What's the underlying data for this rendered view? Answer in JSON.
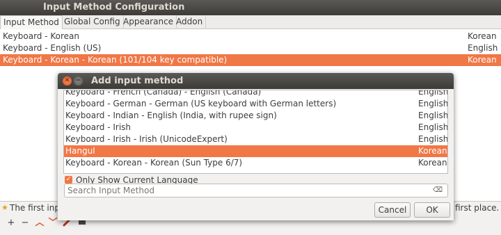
{
  "window": {
    "title": "Input Method Configuration"
  },
  "tabs": [
    {
      "label": "Input Method"
    },
    {
      "label": "Global Config"
    },
    {
      "label": "Appearance"
    },
    {
      "label": "Addon"
    }
  ],
  "main_list": [
    {
      "name": "Keyboard - Korean",
      "lang": "Korean"
    },
    {
      "name": "Keyboard - English (US)",
      "lang": "English"
    },
    {
      "name": "Keyboard - Korean - Korean (101/104 key compatible)",
      "lang": "Korean",
      "selected": true
    }
  ],
  "hint": {
    "left": "The first inpu",
    "right": "first place."
  },
  "toolbar": {
    "add": "+",
    "remove": "−",
    "up": "︿",
    "down": "﹀"
  },
  "dialog": {
    "title": "Add input method",
    "items": [
      {
        "name": "Keyboard - French (Canada) - English (Canada)",
        "lang": "English"
      },
      {
        "name": "Keyboard - German - German (US keyboard with German letters)",
        "lang": "English"
      },
      {
        "name": "Keyboard - Indian - English (India, with rupee sign)",
        "lang": "English"
      },
      {
        "name": "Keyboard - Irish",
        "lang": "English"
      },
      {
        "name": "Keyboard - Irish - Irish (UnicodeExpert)",
        "lang": "English"
      },
      {
        "name": "Hangul",
        "lang": "Korean",
        "selected": true
      },
      {
        "name": "Keyboard - Korean - Korean (Sun Type 6/7)",
        "lang": "Korean"
      }
    ],
    "only_current_label": "Only Show Current Language",
    "only_current_checked": true,
    "search_placeholder": "Search Input Method",
    "cancel_label": "Cancel",
    "ok_label": "OK"
  },
  "colors": {
    "selection": "#f07746",
    "titlebar": "#3c3b37"
  }
}
